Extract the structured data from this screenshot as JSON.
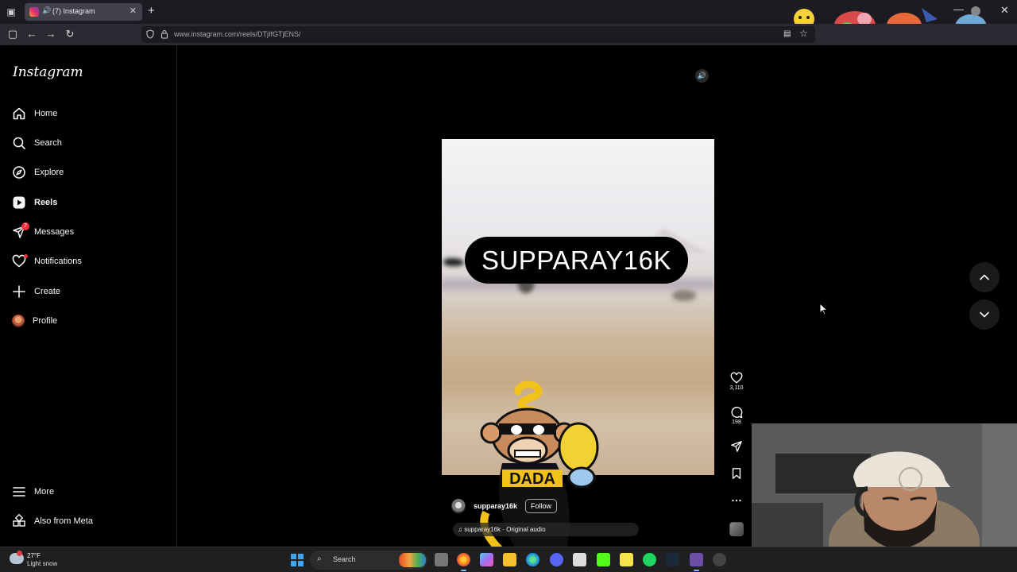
{
  "browser": {
    "tab": {
      "title": "(7) Instagram"
    },
    "url": "www.instagram.com/reels/DTjIfGTjENS/"
  },
  "sidebar": {
    "logo": "Instagram",
    "items": [
      {
        "label": "Home"
      },
      {
        "label": "Search"
      },
      {
        "label": "Explore"
      },
      {
        "label": "Reels",
        "active": true
      },
      {
        "label": "Messages",
        "badge": "7"
      },
      {
        "label": "Notifications"
      },
      {
        "label": "Create"
      },
      {
        "label": "Profile"
      }
    ],
    "bottom": [
      {
        "label": "More"
      },
      {
        "label": "Also from Meta"
      }
    ]
  },
  "reel": {
    "overlay_title": "SUPPARAY16K",
    "author": "supparay16k",
    "follow_label": "Follow",
    "audio": "supparay16k · Original audio",
    "likes": "3,110",
    "comments": "198"
  },
  "taskbar": {
    "temperature": "27°F",
    "condition": "Light snow",
    "search_label": "Search"
  },
  "colors": {
    "background": "#000000",
    "notification_red": "#ff3040",
    "browser_chrome": "#2b2a33"
  }
}
